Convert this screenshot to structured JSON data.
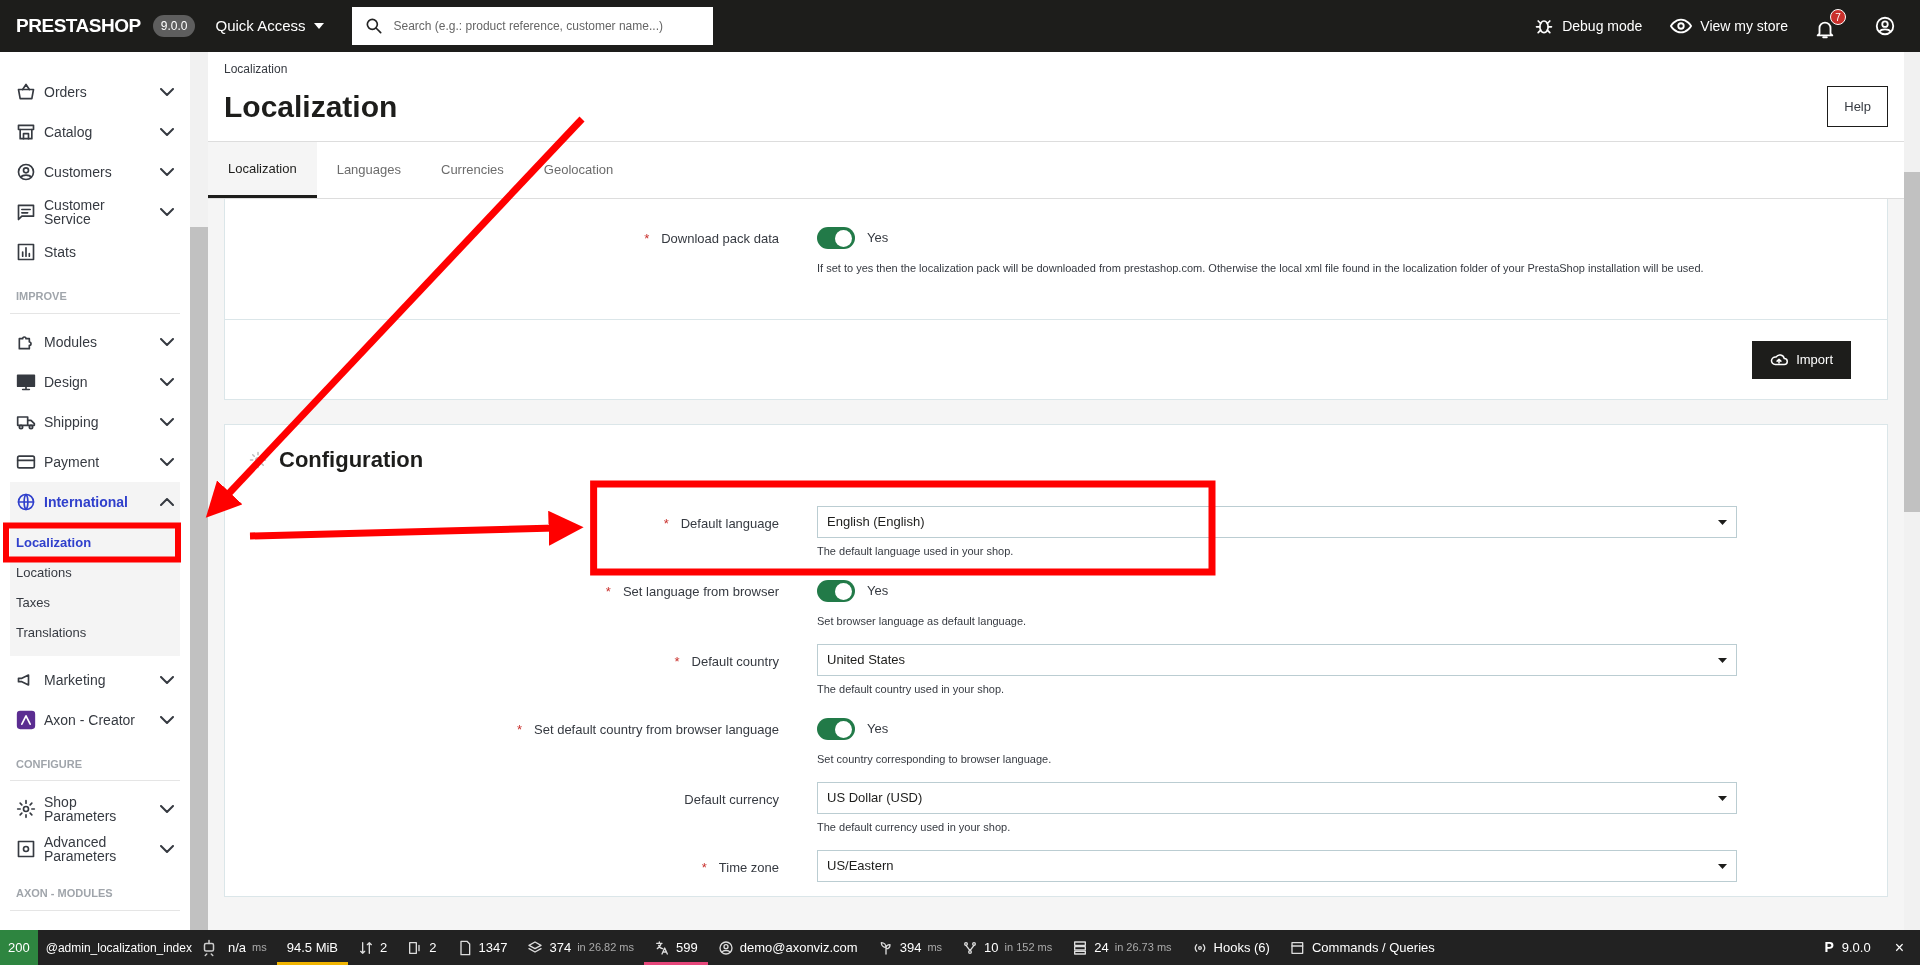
{
  "topbar": {
    "logo": "PRESTASHOP",
    "version": "9.0.0",
    "quick_access": "Quick Access",
    "search": {
      "placeholder": "Search (e.g.: product reference, customer name...)"
    },
    "debug": "Debug mode",
    "view_store": "View my store",
    "notifications": "7"
  },
  "sidebar": {
    "sections": [
      {
        "items": [
          {
            "label": "Orders",
            "expanded": false,
            "selected": false
          },
          {
            "label": "Catalog",
            "expanded": false,
            "selected": false
          },
          {
            "label": "Customers",
            "expanded": false,
            "selected": false
          },
          {
            "label": "Customer Service",
            "expanded": false,
            "selected": false
          },
          {
            "label": "Stats",
            "selected": false
          }
        ]
      },
      {
        "heading": "IMPROVE",
        "items": [
          {
            "label": "Modules",
            "expanded": false,
            "selected": false
          },
          {
            "label": "Design",
            "expanded": false,
            "selected": false
          },
          {
            "label": "Shipping",
            "expanded": false,
            "selected": false
          },
          {
            "label": "Payment",
            "expanded": false,
            "selected": false
          },
          {
            "label": "International",
            "expanded": true,
            "selected": true,
            "children": [
              {
                "label": "Localization",
                "selected": true
              },
              {
                "label": "Locations",
                "selected": false
              },
              {
                "label": "Taxes",
                "selected": false
              },
              {
                "label": "Translations",
                "selected": false
              }
            ]
          },
          {
            "label": "Marketing",
            "expanded": false,
            "selected": false
          },
          {
            "label": "Axon - Creator",
            "expanded": false,
            "selected": false
          }
        ]
      },
      {
        "heading": "CONFIGURE",
        "items": [
          {
            "label": "Shop Parameters",
            "expanded": false,
            "selected": false
          },
          {
            "label": "Advanced Parameters",
            "expanded": false,
            "selected": false
          }
        ]
      },
      {
        "heading": "AXON - MODULES"
      }
    ]
  },
  "header": {
    "breadcrumb": "Localization",
    "title": "Localization",
    "help": "Help"
  },
  "tabs": [
    {
      "label": "Localization",
      "selected": true
    },
    {
      "label": "Languages",
      "selected": false
    },
    {
      "label": "Currencies",
      "selected": false
    },
    {
      "label": "Geolocation",
      "selected": false
    }
  ],
  "import_card": {
    "fields": [
      {
        "kind": "toggle",
        "label": "Download pack data",
        "required": true,
        "required_mark": "*",
        "on": true,
        "value": "Yes",
        "help": "If set to yes then the localization pack will be downloaded from prestashop.com. Otherwise the local xml file found in the localization folder of your PrestaShop installation will be used."
      }
    ],
    "button": "Import"
  },
  "configuration": {
    "title": "Configuration",
    "fields": [
      {
        "kind": "select",
        "label": "Default language",
        "required": true,
        "required_mark": "*",
        "value": "English (English)",
        "help": "The default language used in your shop."
      },
      {
        "kind": "toggle",
        "label": "Set language from browser",
        "required": true,
        "required_mark": "*",
        "on": true,
        "value": "Yes",
        "help": "Set browser language as default language."
      },
      {
        "kind": "select",
        "label": "Default country",
        "required": true,
        "required_mark": "*",
        "value": "United States",
        "help": "The default country used in your shop."
      },
      {
        "kind": "toggle",
        "label": "Set default country from browser language",
        "required": true,
        "required_mark": "*",
        "on": true,
        "value": "Yes",
        "help": "Set country corresponding to browser language."
      },
      {
        "kind": "select",
        "label": "Default currency",
        "required": false,
        "value": "US Dollar (USD)",
        "help": "The default currency used in your shop."
      },
      {
        "kind": "select",
        "label": "Time zone",
        "required": true,
        "required_mark": "*",
        "value": "US/Eastern"
      }
    ]
  },
  "debug_bar": {
    "status": "200",
    "route": "@admin_localization_index",
    "items": [
      {
        "value": "n/a",
        "suffix": "ms"
      },
      {
        "value": "94.5 MiB",
        "color": "#f0b400"
      },
      {
        "value": "2"
      },
      {
        "value": "2"
      },
      {
        "value": "1347"
      },
      {
        "value": "374",
        "suffix": "in 26.82 ms"
      },
      {
        "value": "599",
        "color": "#e5467a"
      },
      {
        "value": "demo@axonviz.com"
      },
      {
        "value": "394",
        "suffix": "ms"
      },
      {
        "value": "10",
        "suffix": "in 152 ms"
      },
      {
        "value": "24",
        "suffix": "in 26.73 ms"
      },
      {
        "value": "Hooks (6)"
      },
      {
        "value": "Commands / Queries"
      }
    ],
    "symfony": "P",
    "version": "9.0.0",
    "close": "×"
  }
}
